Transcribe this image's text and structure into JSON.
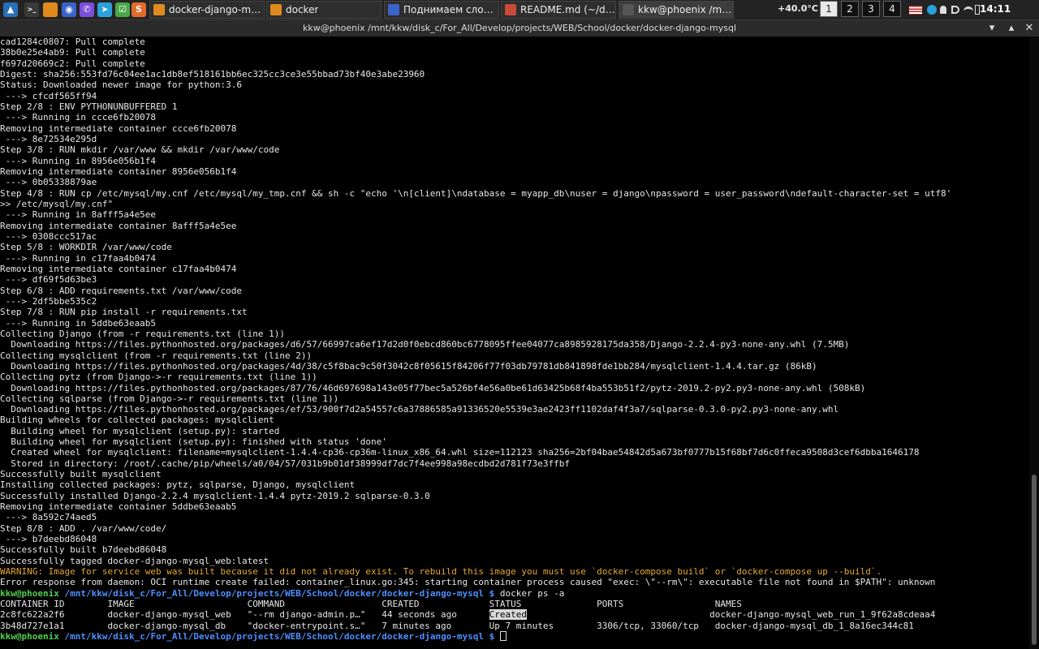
{
  "panel": {
    "launchers": [
      {
        "icon": "app-menu-icon",
        "color": "#2a6fb8",
        "glyph": "▲"
      },
      {
        "icon": "terminal-icon",
        "color": "#3a3a3a",
        "glyph": ">_"
      },
      {
        "icon": "folder-icon",
        "color": "#e08a1e",
        "glyph": ""
      },
      {
        "icon": "browser-icon",
        "color": "#3b64c9",
        "glyph": "◉"
      },
      {
        "icon": "viber-icon",
        "color": "#7c4ddb",
        "glyph": "✆"
      },
      {
        "icon": "telegram-icon",
        "color": "#2aa1da",
        "glyph": "➤"
      },
      {
        "icon": "system-monitor-icon",
        "color": "#4aa84a",
        "glyph": "☑"
      },
      {
        "icon": "sublime-text-icon",
        "color": "#e36b2b",
        "glyph": "S"
      }
    ],
    "tasks": [
      {
        "label": "docker-django-mysql",
        "icon": "folder-icon",
        "color": "#e08a1e"
      },
      {
        "label": "docker",
        "icon": "folder-icon",
        "color": "#e08a1e"
      },
      {
        "label": "Поднимаем сложн...",
        "icon": "browser-icon",
        "color": "#3b64c9"
      },
      {
        "label": "README.md (~/deve...",
        "icon": "text-editor-icon",
        "color": "#c94a3a"
      },
      {
        "label": "kkw@phoenix /mnt/k...",
        "icon": "terminal-icon",
        "color": "#555555"
      }
    ],
    "temperature": "+40.0°C",
    "workspaces": [
      "1",
      "2",
      "3",
      "4"
    ],
    "active_workspace": "1",
    "clock": "14:11",
    "tray_icons": [
      "us-flag-icon",
      "skype-icon",
      "user-icon",
      "volume-icon",
      "wifi-icon",
      "battery-icon"
    ]
  },
  "window": {
    "title": "kkw@phoenix /mnt/kkw/disk_c/For_All/Develop/projects/WEB/School/docker/docker-django-mysql",
    "minimize": "▾",
    "maximize": "▴",
    "close": "✕"
  },
  "terminal": {
    "lines": [
      {
        "text": "cad1284c0807: Pull complete"
      },
      {
        "text": "38b0e25e4ab9: Pull complete"
      },
      {
        "text": "f697d20669c2: Pull complete"
      },
      {
        "text": "Digest: sha256:553fd76c04ee1ac1db8ef518161bb6ec325cc3ce3e55bbad73bf40e3abe23960"
      },
      {
        "text": "Status: Downloaded newer image for python:3.6"
      },
      {
        "text": " ---> cfcdf565ff94"
      },
      {
        "text": "Step 2/8 : ENV PYTHONUNBUFFERED 1"
      },
      {
        "text": " ---> Running in ccce6fb20078"
      },
      {
        "text": "Removing intermediate container ccce6fb20078"
      },
      {
        "text": " ---> 8e72534e295d"
      },
      {
        "text": "Step 3/8 : RUN mkdir /var/www && mkdir /var/www/code"
      },
      {
        "text": " ---> Running in 8956e056b1f4"
      },
      {
        "text": "Removing intermediate container 8956e056b1f4"
      },
      {
        "text": " ---> 0b05338879ae"
      },
      {
        "text": "Step 4/8 : RUN cp /etc/mysql/my.cnf /etc/mysql/my_tmp.cnf && sh -c \"echo '\\n[client]\\ndatabase = myapp_db\\nuser = django\\npassword = user_password\\ndefault-character-set = utf8'"
      },
      {
        "text": ">> /etc/mysql/my.cnf\""
      },
      {
        "text": " ---> Running in 8afff5a4e5ee"
      },
      {
        "text": "Removing intermediate container 8afff5a4e5ee"
      },
      {
        "text": " ---> 0308ccc517ac"
      },
      {
        "text": "Step 5/8 : WORKDIR /var/www/code"
      },
      {
        "text": " ---> Running in c17faa4b0474"
      },
      {
        "text": "Removing intermediate container c17faa4b0474"
      },
      {
        "text": " ---> df69f5d63be3"
      },
      {
        "text": "Step 6/8 : ADD requirements.txt /var/www/code"
      },
      {
        "text": " ---> 2df5bbe535c2"
      },
      {
        "text": "Step 7/8 : RUN pip install -r requirements.txt"
      },
      {
        "text": " ---> Running in 5ddbe63eaab5"
      },
      {
        "text": "Collecting Django (from -r requirements.txt (line 1))"
      },
      {
        "text": "  Downloading https://files.pythonhosted.org/packages/d6/57/66997ca6ef17d2d0f0ebcd860bc6778095ffee04077ca8985928175da358/Django-2.2.4-py3-none-any.whl (7.5MB)"
      },
      {
        "text": "Collecting mysqlclient (from -r requirements.txt (line 2))"
      },
      {
        "text": "  Downloading https://files.pythonhosted.org/packages/4d/38/c5f8bac9c50f3042c8f05615f84206f77f03db79781db841898fde1bb284/mysqlclient-1.4.4.tar.gz (86kB)"
      },
      {
        "text": "Collecting pytz (from Django->-r requirements.txt (line 1))"
      },
      {
        "text": "  Downloading https://files.pythonhosted.org/packages/87/76/46d697698a143e05f77bec5a526bf4e56a0be61d63425b68f4ba553b51f2/pytz-2019.2-py2.py3-none-any.whl (508kB)"
      },
      {
        "text": "Collecting sqlparse (from Django->-r requirements.txt (line 1))"
      },
      {
        "text": "  Downloading https://files.pythonhosted.org/packages/ef/53/900f7d2a54557c6a37886585a91336520e5539e3ae2423ff1102daf4f3a7/sqlparse-0.3.0-py2.py3-none-any.whl"
      },
      {
        "text": "Building wheels for collected packages: mysqlclient"
      },
      {
        "text": "  Building wheel for mysqlclient (setup.py): started"
      },
      {
        "text": "  Building wheel for mysqlclient (setup.py): finished with status 'done'"
      },
      {
        "text": "  Created wheel for mysqlclient: filename=mysqlclient-1.4.4-cp36-cp36m-linux_x86_64.whl size=112123 sha256=2bf04bae54842d5a673bf0777b15f68bf7d6c0ffeca9508d3cef6dbba1646178"
      },
      {
        "text": "  Stored in directory: /root/.cache/pip/wheels/a0/04/57/031b9b01df38999df7dc7f4ee998a98ecdbd2d781f73e3ffbf"
      },
      {
        "text": "Successfully built mysqlclient"
      },
      {
        "text": "Installing collected packages: pytz, sqlparse, Django, mysqlclient"
      },
      {
        "text": "Successfully installed Django-2.2.4 mysqlclient-1.4.4 pytz-2019.2 sqlparse-0.3.0"
      },
      {
        "text": "Removing intermediate container 5ddbe63eaab5"
      },
      {
        "text": " ---> 8a592c74aed5"
      },
      {
        "text": "Step 8/8 : ADD . /var/www/code/"
      },
      {
        "text": " ---> b7deebd86048"
      },
      {
        "text": "Successfully built b7deebd86048"
      },
      {
        "text": "Successfully tagged docker-django-mysql_web:latest"
      },
      {
        "text": "WARNING: Image for service web was built because it did not already exist. To rebuild this image you must use `docker-compose build` or `docker-compose up --build`.",
        "style": "warn"
      },
      {
        "text": "Error response from daemon: OCI runtime create failed: container_linux.go:345: starting container process caused \"exec: \\\"--rm\\\": executable file not found in $PATH\": unknown"
      },
      {
        "prompt": true,
        "user": "kkw@phoenix",
        "path": "/mnt/kkw/disk_c/For_All/Develop/projects/WEB/School/docker/docker-django-mysql $",
        "cmd": " docker ps -a"
      },
      {
        "text": "CONTAINER ID        IMAGE                     COMMAND                  CREATED             STATUS              PORTS                 NAMES"
      },
      {
        "pre": "2c8fc622a2f6        docker-django-mysql_web   \"--rm django-admin.p…\"   44 seconds ago      ",
        "hl": "Created",
        "post": "                                  docker-django-mysql_web_run_1_9f62a8cdeaa4"
      },
      {
        "text": "3b48d727e1a1        docker-django-mysql_db    \"docker-entrypoint.s…\"   7 minutes ago       Up 7 minutes        3306/tcp, 33060/tcp   docker-django-mysql_db_1_8a16ec344c81"
      },
      {
        "prompt": true,
        "user": "kkw@phoenix",
        "path": "/mnt/kkw/disk_c/For_All/Develop/projects/WEB/School/docker/docker-django-mysql $",
        "cmd": " ",
        "cursor": true
      }
    ]
  }
}
